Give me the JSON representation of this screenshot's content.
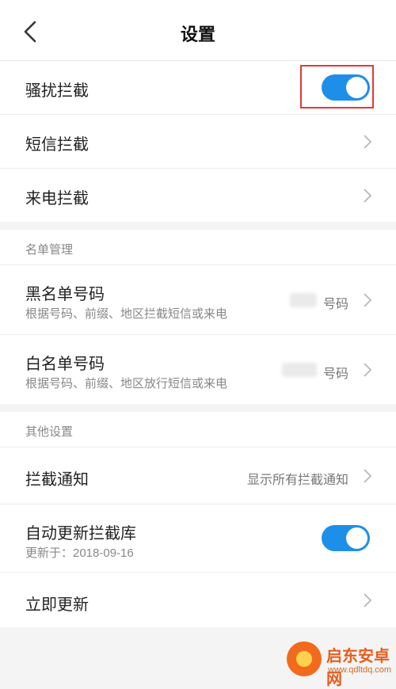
{
  "header": {
    "title": "设置"
  },
  "interception": {
    "items": [
      {
        "label": "骚扰拦截",
        "toggle": "on"
      },
      {
        "label": "短信拦截"
      },
      {
        "label": "来电拦截"
      }
    ]
  },
  "list_management": {
    "header": "名单管理",
    "blacklist": {
      "label": "黑名单号码",
      "sub": "根据号码、前缀、地区拦截短信或来电",
      "value": "号码"
    },
    "whitelist": {
      "label": "白名单号码",
      "sub": "根据号码、前缀、地区放行短信或来电",
      "value": "号码"
    }
  },
  "other": {
    "header": "其他设置",
    "notify": {
      "label": "拦截通知",
      "value": "显示所有拦截通知"
    },
    "auto_update": {
      "label": "自动更新拦截库",
      "sub": "更新于：2018-09-16",
      "toggle": "on"
    },
    "update_now": {
      "label": "立即更新"
    }
  },
  "watermark": {
    "name": "启东安卓网",
    "url": "www.qdltdq.com"
  },
  "colors": {
    "toggle_on": "#1e8fe8",
    "highlight": "#e53935"
  }
}
